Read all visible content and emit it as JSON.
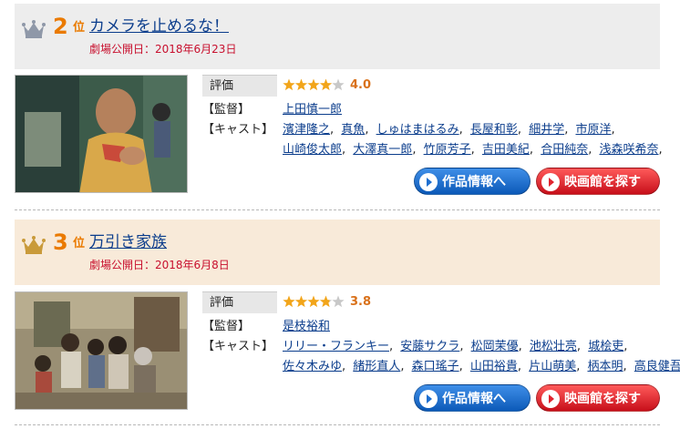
{
  "colors": {
    "rank_orange": "#ea7a00",
    "title_link": "#0b3d8c",
    "release_red": "#c8102e",
    "info_button_blue": "#1e6fd0",
    "theater_button_red": "#e0242e",
    "star_gold": "#f2a51a"
  },
  "entries": [
    {
      "crown_icon": "silver-crown-icon",
      "rank": "2",
      "rank_suffix": "位",
      "title": "カメラを止めるな！",
      "release": "劇場公開日：2018年6月23日",
      "rating_label": "評価",
      "rating_value": "4.0",
      "rating_stars": 4,
      "director_label": "【監督】",
      "directors": [
        "上田慎一郎"
      ],
      "cast_label": "【キャスト】",
      "cast_line1": [
        "濱津隆之",
        "真魚",
        "しゅはまはるみ",
        "長屋和彰",
        "細井学",
        "市原洋"
      ],
      "cast_line2": [
        "山崎俊太郎",
        "大澤真一郎",
        "竹原芳子",
        "吉田美紀",
        "合田純奈",
        "浅森咲希奈"
      ],
      "info_button": "作品情報へ",
      "theater_button": "映画館を探す"
    },
    {
      "crown_icon": "gold-crown-icon",
      "rank": "3",
      "rank_suffix": "位",
      "title": "万引き家族",
      "release": "劇場公開日：2018年6月8日",
      "rating_label": "評価",
      "rating_value": "3.8",
      "rating_stars": 3.8,
      "director_label": "【監督】",
      "directors": [
        "是枝裕和"
      ],
      "cast_label": "【キャスト】",
      "cast_line1": [
        "リリー・フランキー",
        "安藤サクラ",
        "松岡茉優",
        "池松壮亮",
        "城桧吏"
      ],
      "cast_line2": [
        "佐々木みゆ",
        "緒形直人",
        "森口瑤子",
        "山田裕貴",
        "片山萌美",
        "柄本明",
        "高良健吾"
      ],
      "info_button": "作品情報へ",
      "theater_button": "映画館を探す"
    }
  ]
}
